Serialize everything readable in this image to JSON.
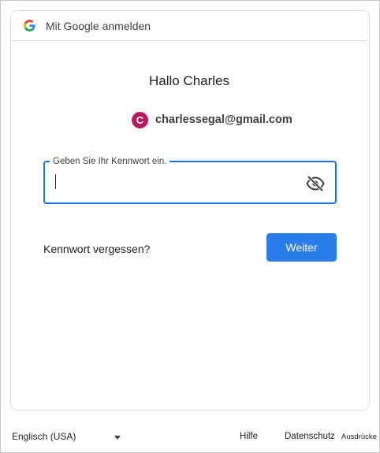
{
  "header": {
    "title": "Mit Google anmelden",
    "logo_icon": "google-g-icon"
  },
  "account": {
    "greeting": "Hallo Charles",
    "avatar_initial": "C",
    "avatar_color": "#b8195f",
    "email": "charlessegal@gmail.com"
  },
  "password": {
    "label": "Geben Sie Ihr Kennwort ein.",
    "value": "",
    "visibility_icon": "eye-off-icon"
  },
  "actions": {
    "forgot_label": "Kennwort vergessen?",
    "next_label": "Weiter",
    "accent_color": "#1a73e8"
  },
  "footer": {
    "language": "Englisch (USA)",
    "help": "Hilfe",
    "privacy": "Datenschutz",
    "terms": "Ausdrücke"
  }
}
